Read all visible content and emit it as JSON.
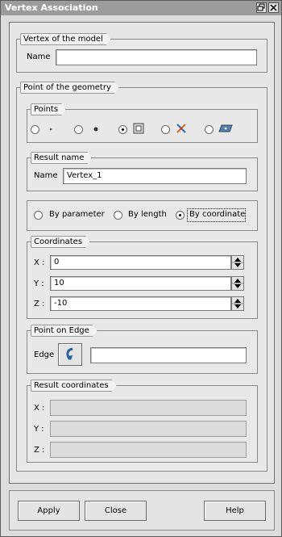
{
  "window": {
    "title": "Vertex Association",
    "restore_icon": "restore-icon",
    "close_icon": "close-icon"
  },
  "model_vertex": {
    "group_title": "Vertex of the model",
    "name_label": "Name",
    "name_value": ""
  },
  "geometry_point": {
    "group_title": "Point of the geometry",
    "points": {
      "group_title": "Points",
      "options": [
        {
          "icon": "point-small-icon",
          "selected": false
        },
        {
          "icon": "point-dot-icon",
          "selected": false
        },
        {
          "icon": "point-box-icon",
          "selected": true
        },
        {
          "icon": "point-cross-icon",
          "selected": false
        },
        {
          "icon": "point-plane-icon",
          "selected": false
        }
      ]
    },
    "result_name": {
      "group_title": "Result name",
      "name_label": "Name",
      "name_value": "Vertex_1"
    },
    "mode": {
      "by_parameter": "By parameter",
      "by_length": "By length",
      "by_coordinate": "By coordinate",
      "selected": "By coordinate"
    },
    "coordinates": {
      "group_title": "Coordinates",
      "x_label": "X :",
      "x_value": "0",
      "y_label": "Y :",
      "y_value": "10",
      "z_label": "Z :",
      "z_value": "-10"
    },
    "point_on_edge": {
      "group_title": "Point on Edge",
      "edge_label": "Edge",
      "edge_value": "",
      "select_icon": "select-arrow-icon"
    },
    "result_coordinates": {
      "group_title": "Result coordinates",
      "x_label": "X :",
      "x_value": "",
      "y_label": "Y :",
      "y_value": "",
      "z_label": "Z :",
      "z_value": ""
    }
  },
  "buttons": {
    "apply": "Apply",
    "close": "Close",
    "help": "Help"
  }
}
